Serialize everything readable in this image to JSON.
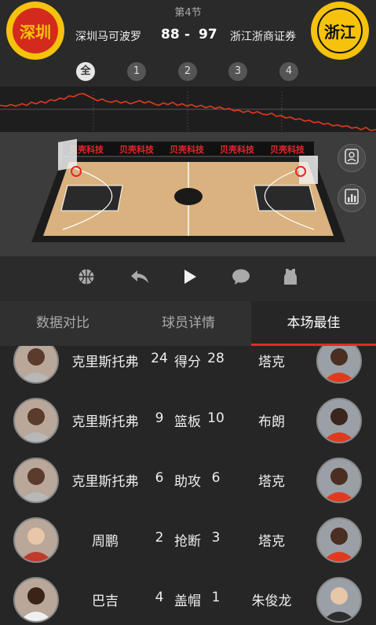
{
  "header": {
    "period": "第4节",
    "home_team": "深圳马可波罗",
    "away_team": "浙江浙商证券",
    "home_score": "88",
    "separator": "-",
    "away_score": "97",
    "home_logo_text": "深圳",
    "away_logo_text": "浙江",
    "home_color": "#d42a1e",
    "away_color": "#f5c20c"
  },
  "quarter_tabs": [
    "全",
    "1",
    "2",
    "3",
    "4"
  ],
  "selected_quarter": "全",
  "court": {
    "sponsor": "贝壳科技",
    "icons": [
      "player-card-icon",
      "stats-chart-icon"
    ]
  },
  "controls": [
    "basketball-icon",
    "back-icon",
    "play-icon",
    "comment-icon",
    "jersey-icon"
  ],
  "tabs": [
    "数据对比",
    "球员详情",
    "本场最佳"
  ],
  "active_tab": "本场最佳",
  "leaders": [
    {
      "home_player": "克里斯托弗",
      "home_value": "24",
      "stat": "得分",
      "away_value": "28",
      "away_player": "塔克"
    },
    {
      "home_player": "克里斯托弗",
      "home_value": "9",
      "stat": "篮板",
      "away_value": "10",
      "away_player": "布朗"
    },
    {
      "home_player": "克里斯托弗",
      "home_value": "6",
      "stat": "助攻",
      "away_value": "6",
      "away_player": "塔克"
    },
    {
      "home_player": "周鹏",
      "home_value": "2",
      "stat": "抢断",
      "away_value": "3",
      "away_player": "塔克"
    },
    {
      "home_player": "巴吉",
      "home_value": "4",
      "stat": "盖帽",
      "away_value": "1",
      "away_player": "朱俊龙"
    }
  ],
  "colors": {
    "accent": "#e8262c",
    "background": "#262626"
  }
}
